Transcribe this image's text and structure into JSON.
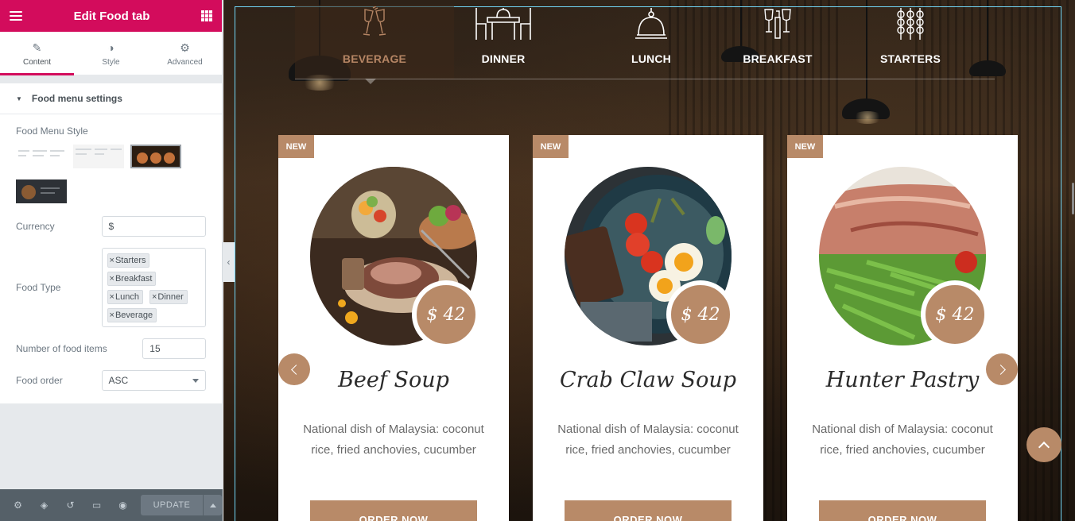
{
  "panel": {
    "title": "Edit Food tab",
    "tabs": [
      {
        "label": "Content",
        "icon": "pencil-icon"
      },
      {
        "label": "Style",
        "icon": "contrast-icon"
      },
      {
        "label": "Advanced",
        "icon": "gear-icon"
      }
    ],
    "section_title": "Food menu settings",
    "food_menu_style_label": "Food Menu Style",
    "currency": {
      "label": "Currency",
      "value": "$"
    },
    "food_type": {
      "label": "Food Type",
      "tags": [
        "Starters",
        "Breakfast",
        "Lunch",
        "Dinner",
        "Beverage"
      ]
    },
    "number_of_items": {
      "label": "Number of food items",
      "value": "15"
    },
    "food_order": {
      "label": "Food order",
      "value": "ASC"
    },
    "footer": {
      "update_label": "UPDATE"
    },
    "accent_color": "#d30c5c"
  },
  "preview": {
    "tabs": [
      {
        "label": "BEVERAGE",
        "icon": "wine-glasses-icon"
      },
      {
        "label": "DINNER",
        "icon": "dining-table-icon"
      },
      {
        "label": "LUNCH",
        "icon": "cloche-icon"
      },
      {
        "label": "BREAKFAST",
        "icon": "champagne-icon"
      },
      {
        "label": "STARTERS",
        "icon": "skewers-icon"
      }
    ],
    "cards": [
      {
        "badge": "NEW",
        "price": "$ 42",
        "name": "Beef Soup",
        "description": "National dish of Malaysia: coconut rice, fried anchovies, cucumber",
        "button": "ORDER NOW"
      },
      {
        "badge": "NEW",
        "price": "$ 42",
        "name": "Crab Claw Soup",
        "description": "National dish of Malaysia: coconut rice, fried anchovies, cucumber",
        "button": "ORDER NOW"
      },
      {
        "badge": "NEW",
        "price": "$ 42",
        "name": "Hunter Pastry",
        "description": "National dish of Malaysia: coconut rice, fried anchovies, cucumber",
        "button": "ORDER NOW"
      }
    ],
    "accent_color": "#b88a68"
  }
}
